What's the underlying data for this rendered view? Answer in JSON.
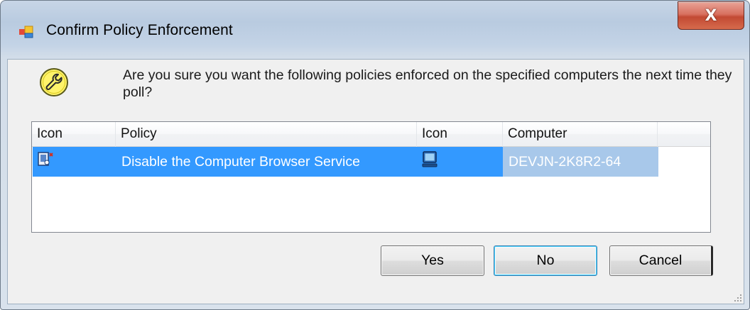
{
  "window": {
    "title": "Confirm Policy Enforcement",
    "icons": {
      "app": "window-app-icon",
      "close": "close-icon"
    },
    "close_glyph": "X"
  },
  "message": {
    "icon": "wrench-warning-icon",
    "text": "Are you sure you want the following policies enforced on the specified computers the next time they poll?"
  },
  "list": {
    "columns": [
      "Icon",
      "Policy",
      "Icon",
      "Computer"
    ],
    "rows": [
      {
        "policy_icon": "policy-service-icon",
        "policy": "Disable the Computer Browser Service",
        "computer_icon": "computer-monitor-icon",
        "computer": "DEVJN-2K8R2-64"
      }
    ]
  },
  "buttons": {
    "yes": "Yes",
    "no": "No",
    "cancel": "Cancel"
  },
  "colors": {
    "selection": "#3399ff",
    "selection_unfocused": "#a8c8ea",
    "close_button": "#c84d37",
    "title_bar": "#bdd0e6"
  }
}
